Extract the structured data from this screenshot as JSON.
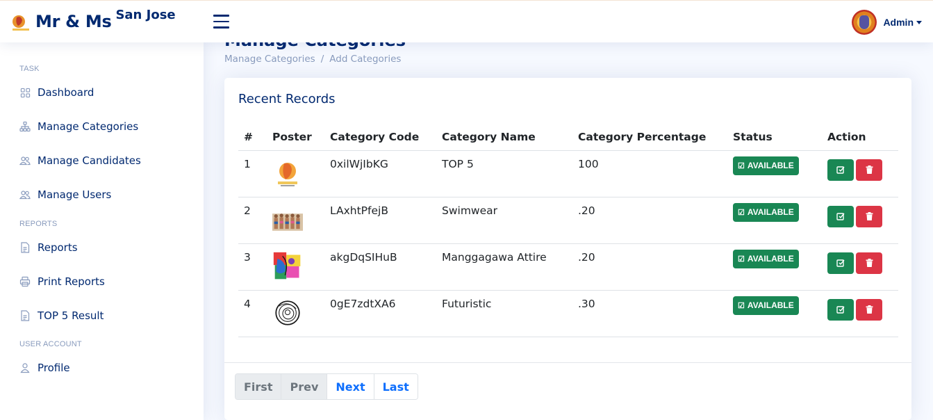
{
  "header": {
    "title": "Mr & Ms",
    "subtitle": "San Jose",
    "user_name": "Admin"
  },
  "sidebar": {
    "sections": [
      {
        "heading": "TASK",
        "items": [
          {
            "label": "Dashboard",
            "icon": "grid-icon"
          },
          {
            "label": "Manage Categories",
            "icon": "diagram-icon"
          },
          {
            "label": "Manage Candidates",
            "icon": "people-icon"
          },
          {
            "label": "Manage Users",
            "icon": "people-icon"
          }
        ]
      },
      {
        "heading": "REPORTS",
        "items": [
          {
            "label": "Reports",
            "icon": "file-icon"
          },
          {
            "label": "Print Reports",
            "icon": "printer-icon"
          },
          {
            "label": "TOP 5 Result",
            "icon": "file-icon"
          }
        ]
      },
      {
        "heading": "USER ACCOUNT",
        "items": [
          {
            "label": "Profile",
            "icon": "person-icon"
          }
        ]
      }
    ]
  },
  "page": {
    "title": "Manage Categories",
    "breadcrumb": [
      "Manage Categories",
      "Add Categories"
    ]
  },
  "card": {
    "title": "Recent Records",
    "columns": [
      "#",
      "Poster",
      "Category Code",
      "Category Name",
      "Category Percentage",
      "Status",
      "Action"
    ],
    "rows": [
      {
        "idx": "1",
        "code": "0xilWjIbKG",
        "name": "TOP 5",
        "percentage": "100",
        "status": "AVAILABLE",
        "poster": "pageant-logo"
      },
      {
        "idx": "2",
        "code": "LAxhtPfejB",
        "name": "Swimwear",
        "percentage": ".20",
        "status": "AVAILABLE",
        "poster": "swimwear-group"
      },
      {
        "idx": "3",
        "code": "akgDqSIHuB",
        "name": "Manggagawa Attire",
        "percentage": ".20",
        "status": "AVAILABLE",
        "poster": "colorful-art"
      },
      {
        "idx": "4",
        "code": "0gE7zdtXA6",
        "name": "Futuristic",
        "percentage": ".30",
        "status": "AVAILABLE",
        "poster": "spiral-sketch"
      }
    ]
  },
  "pagination": {
    "first": "First",
    "prev": "Prev",
    "next": "Next",
    "last": "Last"
  },
  "colors": {
    "brand": "#012970",
    "success": "#198754",
    "danger": "#dc3545",
    "link": "#0d6efd"
  }
}
